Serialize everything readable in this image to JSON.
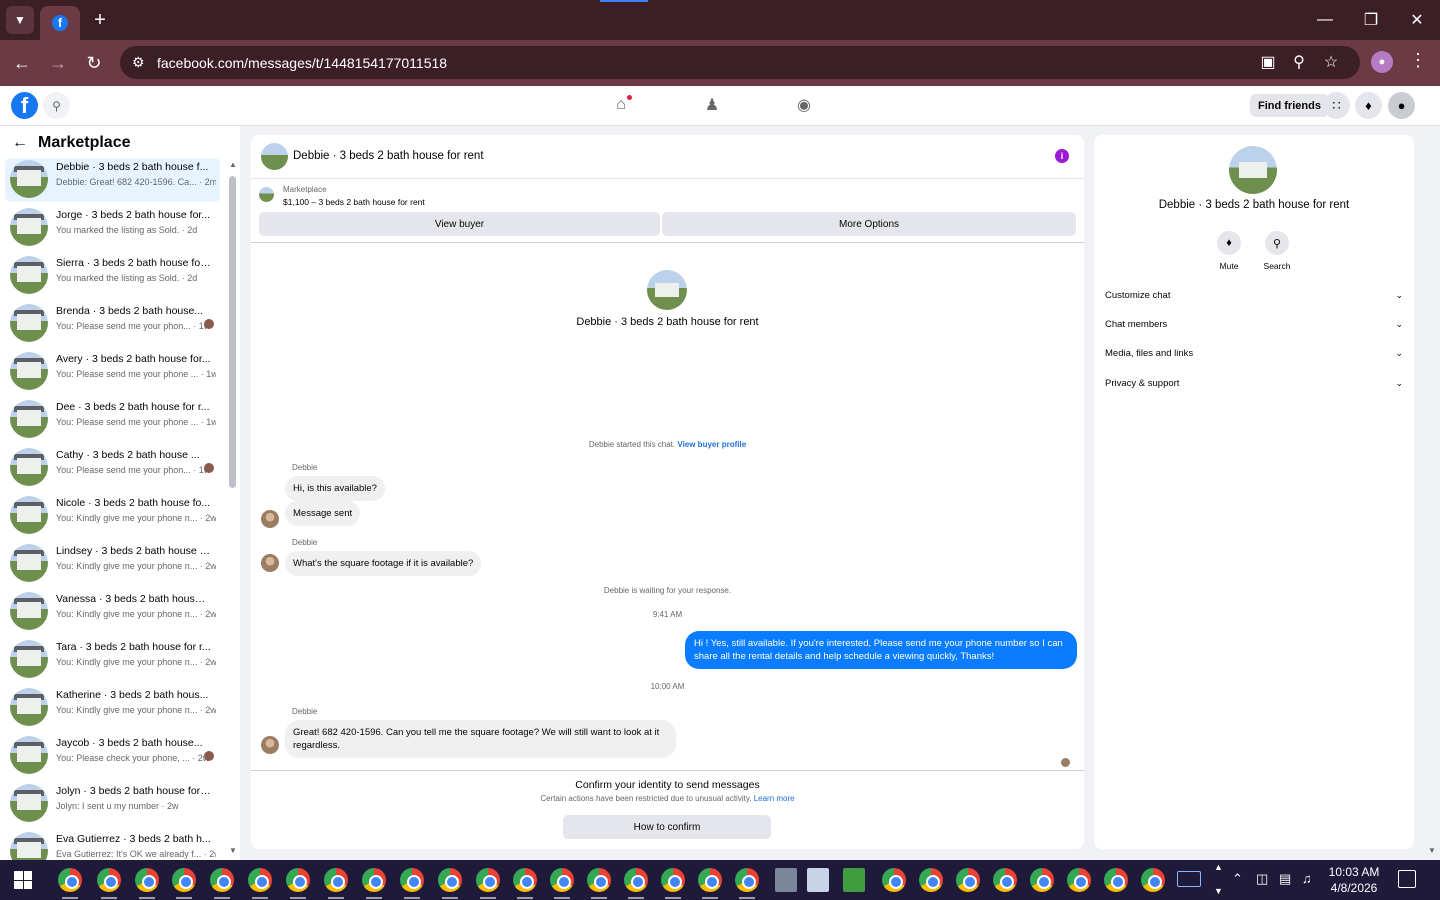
{
  "browser": {
    "url": "facebook.com/messages/t/1448154177011518"
  },
  "header": {
    "find_friends": "Find friends"
  },
  "sidebar": {
    "title": "Marketplace",
    "conversations": [
      {
        "name": "Debbie · 3 beds 2 bath house f...",
        "snippet": "Debbie: Great! 682 420-1596. Ca...  · 2m",
        "active": true
      },
      {
        "name": "Jorge · 3 beds 2 bath house for...",
        "snippet": "You marked the listing as Sold. · 2d"
      },
      {
        "name": "Sierra · 3 beds 2 bath house for...",
        "snippet": "You marked the listing as Sold. · 2d"
      },
      {
        "name": "Brenda · 3 beds 2 bath house...",
        "snippet": "You: Please send me your phon... · 1w"
      },
      {
        "name": "Avery · 3 beds 2 bath house for...",
        "snippet": "You: Please send me your phone ... · 1w"
      },
      {
        "name": "Dee · 3 beds 2 bath house for r...",
        "snippet": "You: Please send me your phone ... · 1w"
      },
      {
        "name": "Cathy · 3 beds 2 bath house ...",
        "snippet": "You: Please send me your phon... · 1w"
      },
      {
        "name": "Nicole · 3 beds 2 bath house fo...",
        "snippet": "You: Kindly give me your phone n... · 2w"
      },
      {
        "name": "Lindsey · 3 beds 2 bath house f...",
        "snippet": "You: Kindly give me your phone n... · 2w"
      },
      {
        "name": "Vanessa · 3 beds 2 bath house f...",
        "snippet": "You: Kindly give me your phone n... · 2w"
      },
      {
        "name": "Tara · 3 beds 2 bath house for r...",
        "snippet": "You: Kindly give me your phone n... · 2w"
      },
      {
        "name": "Katherine · 3 beds 2 bath hous...",
        "snippet": "You: Kindly give me your phone n... · 2w"
      },
      {
        "name": "Jaycob · 3 beds 2 bath house...",
        "snippet": "You: Please check your phone, ... · 2w"
      },
      {
        "name": "Jolyn · 3 beds 2 bath house for ...",
        "snippet": "Jolyn: I sent u my number · 2w"
      },
      {
        "name": "Eva Gutierrez · 3 beds 2 bath h...",
        "snippet": "Eva Gutierrez: It's OK we already f... · 2w"
      }
    ]
  },
  "chat": {
    "title": "Debbie · 3 beds 2 bath house for rent",
    "marketplace_label": "Marketplace",
    "listing_price": "$1,100 – 3 beds 2 bath house for rent",
    "view_buyer": "View buyer",
    "more_options": "More Options",
    "center_name": "Debbie · 3 beds 2 bath house for rent",
    "started_text": "Debbie started this chat.",
    "view_buyer_profile": "View buyer profile",
    "sender_name": "Debbie",
    "msg1": "Hi, is this available?",
    "msg2": "Message sent",
    "msg3": "What's the square footage if it is available?",
    "waiting": "Debbie is waiting for your response.",
    "time1": "9:41 AM",
    "out_msg": "Hi ! Yes, still available. If you're interested, Please send me your phone number so I can share all the rental details and help schedule a viewing quickly, Thanks!",
    "time2": "10:00 AM",
    "msg4": "Great! 682 420-1596. Can you tell me the square footage? We will still want to look at it regardless.",
    "confirm_title": "Confirm your identity to send messages",
    "confirm_sub": "Certain actions have been restricted due to unusual activity.",
    "learn_more": "Learn more",
    "how_to_confirm": "How to confirm"
  },
  "details": {
    "name": "Debbie · 3 beds 2 bath house for rent",
    "mute": "Mute",
    "search": "Search",
    "sections": [
      "Customize chat",
      "Chat members",
      "Media, files and links",
      "Privacy & support"
    ]
  },
  "taskbar": {
    "time": "10:03 AM",
    "date": "4/8/2026"
  }
}
